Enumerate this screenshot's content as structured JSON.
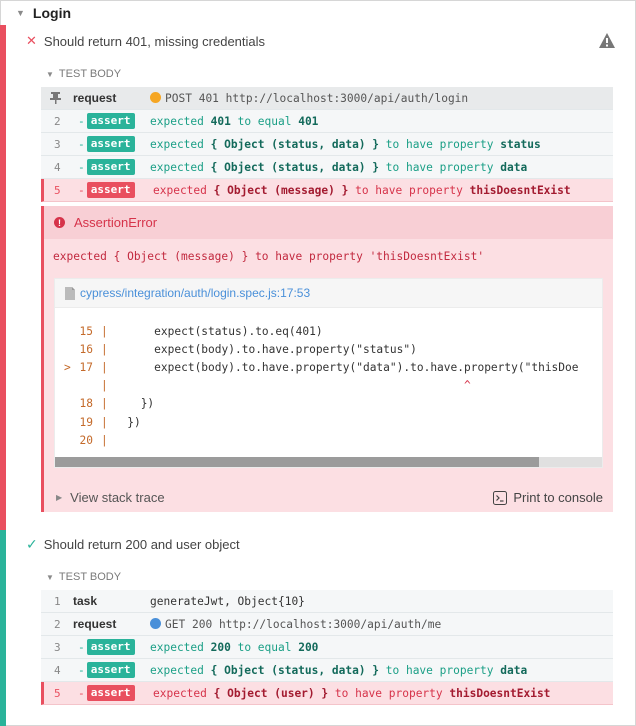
{
  "suite": {
    "title": "Login",
    "tests": [
      {
        "title": "Should return 401, missing credentials",
        "status": "failed",
        "section_label": "TEST BODY",
        "commands": [
          {
            "num": "",
            "name": "request",
            "method": "POST",
            "status": "401",
            "url": "http://localhost:3000/api/auth/login",
            "dot_color": "#f5a623"
          },
          {
            "num": "2",
            "badge": "assert",
            "parts": [
              [
                "t",
                "expected "
              ],
              [
                "b",
                "401"
              ],
              [
                "t",
                " to equal "
              ],
              [
                "b",
                "401"
              ]
            ]
          },
          {
            "num": "3",
            "badge": "assert",
            "parts": [
              [
                "t",
                "expected "
              ],
              [
                "b",
                "{ Object (status, data) }"
              ],
              [
                "t",
                " to have property "
              ],
              [
                "b",
                "status"
              ]
            ]
          },
          {
            "num": "4",
            "badge": "assert",
            "parts": [
              [
                "t",
                "expected "
              ],
              [
                "b",
                "{ Object (status, data) }"
              ],
              [
                "t",
                " to have property "
              ],
              [
                "b",
                "data"
              ]
            ]
          },
          {
            "num": "5",
            "badge": "assert",
            "error": true,
            "parts": [
              [
                "t",
                "expected "
              ],
              [
                "b",
                "{ Object (message) }"
              ],
              [
                "t",
                " to have property "
              ],
              [
                "b",
                "thisDoesntExist"
              ]
            ]
          }
        ],
        "error": {
          "name": "AssertionError",
          "message": "expected { Object (message) } to have property 'thisDoesntExist'",
          "file": "cypress/integration/auth/login.spec.js:17:53",
          "code_lines": [
            {
              "ln": "15",
              "code": "      expect(status).to.eq(401)"
            },
            {
              "ln": "16",
              "code": "      expect(body).to.have.property(\"status\")"
            },
            {
              "ln": "17",
              "code": "      expect(body).to.have.property(\"data\").to.have.property(\"thisDoe",
              "arrow": ">"
            },
            {
              "ln": "",
              "code": "                                                    ^"
            },
            {
              "ln": "18",
              "code": "    })"
            },
            {
              "ln": "19",
              "code": "  })"
            },
            {
              "ln": "20",
              "code": ""
            }
          ],
          "stack_label": "View stack trace",
          "print_label": "Print to console"
        }
      },
      {
        "title": "Should return 200 and user object",
        "status": "passed",
        "section_label": "TEST BODY",
        "commands": [
          {
            "num": "1",
            "name": "task",
            "args": "generateJwt, Object{10}"
          },
          {
            "num": "2",
            "name": "request",
            "method": "GET",
            "status": "200",
            "url": "http://localhost:3000/api/auth/me",
            "dot_color": "#4a90d9"
          },
          {
            "num": "3",
            "badge": "assert",
            "parts": [
              [
                "t",
                "expected "
              ],
              [
                "b",
                "200"
              ],
              [
                "t",
                " to equal "
              ],
              [
                "b",
                "200"
              ]
            ]
          },
          {
            "num": "4",
            "badge": "assert",
            "parts": [
              [
                "t",
                "expected "
              ],
              [
                "b",
                "{ Object (status, data) }"
              ],
              [
                "t",
                " to have property "
              ],
              [
                "b",
                "data"
              ]
            ]
          },
          {
            "num": "5",
            "badge": "assert",
            "error": true,
            "parts": [
              [
                "t",
                "expected "
              ],
              [
                "b",
                "{ Object (user) }"
              ],
              [
                "t",
                " to have property "
              ],
              [
                "b",
                "thisDoesntExist"
              ]
            ]
          }
        ]
      }
    ]
  },
  "colors": {
    "fail": "#e94f5f",
    "pass": "#2ab39a",
    "link": "#4a90d9"
  }
}
